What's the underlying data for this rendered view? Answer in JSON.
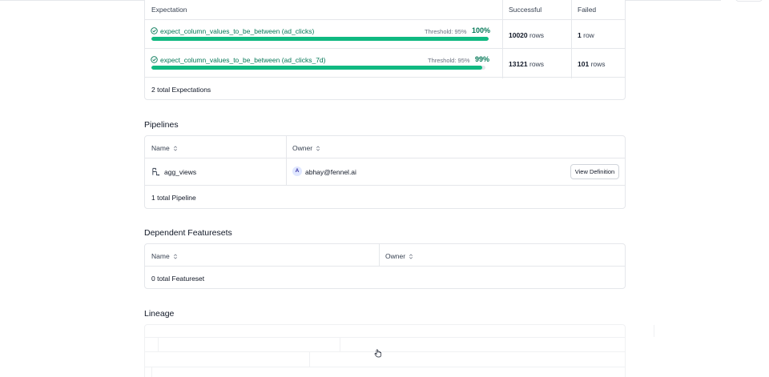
{
  "expectations": {
    "headers": {
      "expectation": "Expectation",
      "successful": "Successful",
      "failed": "Failed"
    },
    "rows": [
      {
        "name": "expect_column_values_to_be_between (ad_clicks)",
        "threshold": "Threshold: 95%",
        "percent": "100%",
        "progress": 1.0,
        "success_count": "10020",
        "success_unit": "rows",
        "failed_count": "1",
        "failed_unit": "row"
      },
      {
        "name": "expect_column_values_to_be_between (ad_clicks_7d)",
        "threshold": "Threshold: 95%",
        "percent": "99%",
        "progress": 0.99,
        "success_count": "13121",
        "success_unit": "rows",
        "failed_count": "101",
        "failed_unit": "rows"
      }
    ],
    "total": "2 total Expectations",
    "accent": "#10b981"
  },
  "pipelines": {
    "title": "Pipelines",
    "headers": {
      "name": "Name",
      "owner": "Owner"
    },
    "rows": [
      {
        "name": "agg_views",
        "avatar": "A",
        "owner": "abhay@fennel.ai",
        "action": "View Definition"
      }
    ],
    "total": "1 total Pipeline"
  },
  "dependent_featuresets": {
    "title": "Dependent Featuresets",
    "headers": {
      "name": "Name",
      "owner": "Owner"
    },
    "total": "0 total Featureset"
  },
  "lineage": {
    "title": "Lineage"
  }
}
